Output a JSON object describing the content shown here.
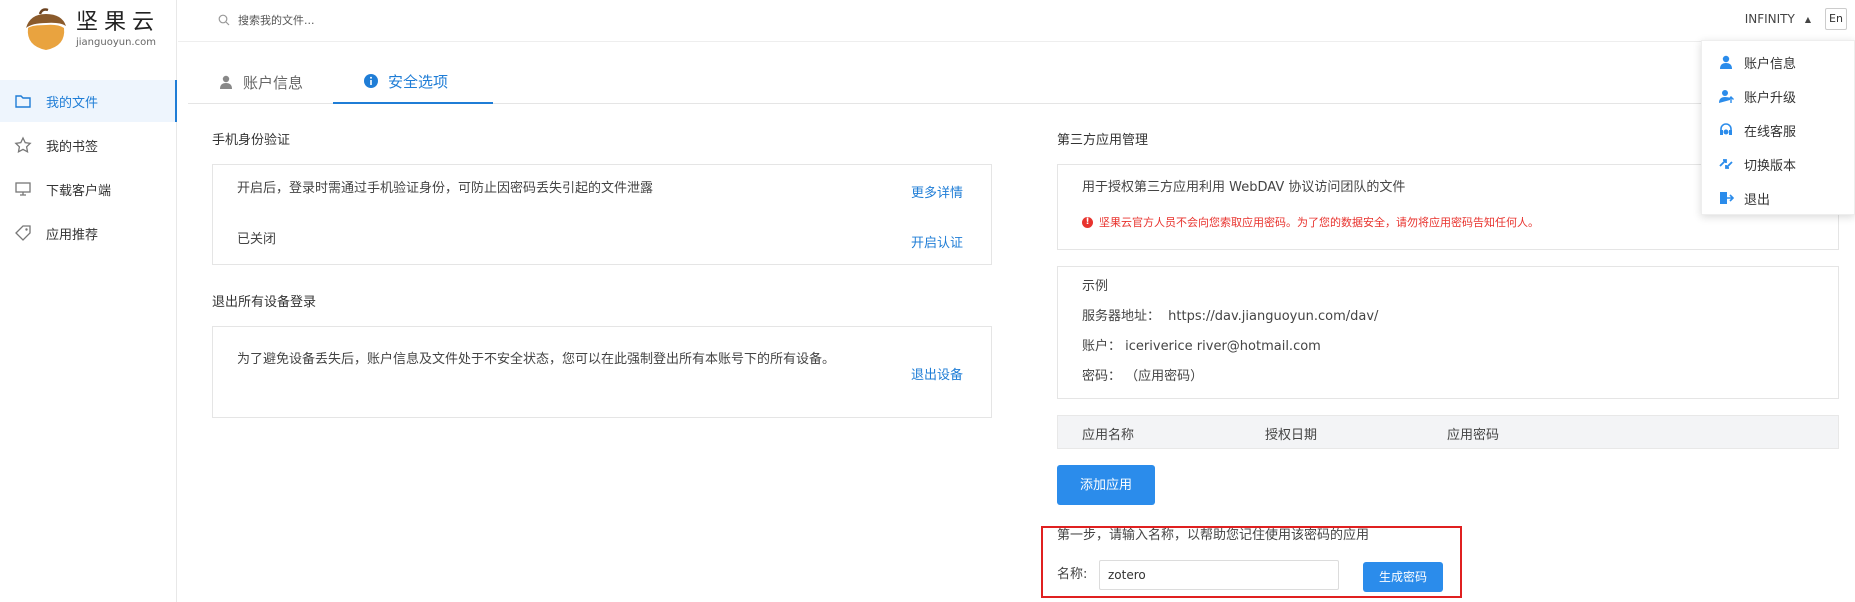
{
  "logo": {
    "cn": "坚果云",
    "en": "jianguoyun.com"
  },
  "sidebar": {
    "items": [
      {
        "label": "我的文件",
        "icon": "folder-icon"
      },
      {
        "label": "我的书签",
        "icon": "star-icon"
      },
      {
        "label": "下载客户端",
        "icon": "monitor-icon"
      },
      {
        "label": "应用推荐",
        "icon": "tag-icon"
      }
    ]
  },
  "topbar": {
    "search_placeholder": "搜索我的文件...",
    "user": "INFINITY",
    "lang": "En"
  },
  "dropdown": {
    "items": [
      "账户信息",
      "账户升级",
      "在线客服",
      "切换版本",
      "退出"
    ]
  },
  "tabs": [
    {
      "label": "账户信息"
    },
    {
      "label": "安全选项"
    }
  ],
  "phone_auth": {
    "title": "手机身份验证",
    "desc": "开启后，登录时需通过手机验证身份，可防止因密码丢失引起的文件泄露",
    "more_link": "更多详情",
    "status": "已关闭",
    "enable_link": "开启认证"
  },
  "logout_all": {
    "title": "退出所有设备登录",
    "desc": "为了避免设备丢失后，账户信息及文件处于不安全状态，您可以在此强制登出所有本账号下的所有设备。",
    "link": "退出设备"
  },
  "third_party": {
    "title": "第三方应用管理",
    "desc": "用于授权第三方应用利用 WebDAV 协议访问团队的文件",
    "warning": "坚果云官方人员不会向您索取应用密码。为了您的数据安全，请勿将应用密码告知任何人。",
    "example_title": "示例",
    "server_label": "服务器地址：",
    "server_value": "https://dav.jianguoyun.com/dav/",
    "account_label": "账户：",
    "account_value": "iceriverice river@hotmail.com",
    "password_label": "密码：",
    "password_value": "（应用密码）",
    "columns": [
      "应用名称",
      "授权日期",
      "应用密码"
    ],
    "add_button": "添加应用",
    "step_text": "第一步，请输入名称，以帮助您记住使用该密码的应用",
    "name_label": "名称:",
    "name_value": "zotero",
    "generate_button": "生成密码"
  },
  "colors": {
    "accent": "#1f7dd6",
    "button": "#2b8ceb",
    "warning": "#e8332e",
    "highlight": "#e02020"
  }
}
